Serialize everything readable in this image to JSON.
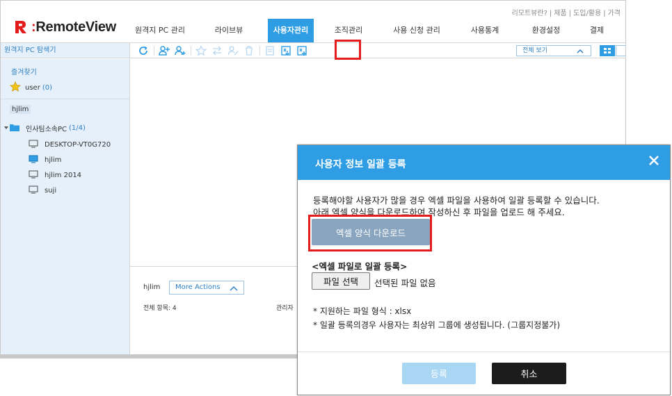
{
  "toplinks": [
    "리모트뷰란?",
    "제품",
    "도입/활용",
    "가격"
  ],
  "app": {
    "name": "RemoteView",
    "brand_color": "#e31b1b"
  },
  "nav": [
    {
      "label": "원격지 PC 관리"
    },
    {
      "label": "라이브뷰"
    },
    {
      "label": "사용자관리"
    },
    {
      "label": "조직관리"
    },
    {
      "label": "사용 신청 관리"
    },
    {
      "label": "사용통계"
    },
    {
      "label": "환경설정"
    },
    {
      "label": "결제"
    }
  ],
  "sidebar": {
    "title": "원격지 PC 탐색기",
    "favorites_title": "즐겨찾기",
    "fav_user": "user",
    "fav_count": "(0)",
    "group": "hjlim",
    "folder": "인사팀소속PC",
    "folder_count": "(1/4)",
    "pcs": [
      {
        "name": "DESKTOP-VT0G720"
      },
      {
        "name": "hjlim"
      },
      {
        "name": "hjlim 2014"
      },
      {
        "name": "suji"
      }
    ]
  },
  "toolbar": {
    "view_select": "전체 보기"
  },
  "bottom": {
    "user": "hjlim",
    "more_actions": "More Actions",
    "total": "전체 항목: 4",
    "admin": "관리자"
  },
  "dialog": {
    "title": "사용자 정보 일괄 등록",
    "desc1": "등록해야할 사용자가 많을 경우 엑셀 파일을 사용하여 일괄 등록할 수 있습니다.",
    "desc2": "아래 엑셀 양식을 다운로드하여 작성하신 후 파일을 업로드 해 주세요.",
    "download_button": "엑셀 양식 다운로드",
    "upload_title": "<엑셀 파일로 일괄 등록>",
    "file_button": "파일 선택",
    "file_none": "선택된 파일 없음",
    "note1": "* 지원하는 파일 형식 : xlsx",
    "note2": "* 일괄 등록의경우 사용자는 최상위 그룹에 생성됩니다. (그룹지정불가)",
    "ok_button": "등록",
    "cancel_button": "취소"
  },
  "colors": {
    "accent": "#2f9de3",
    "highlight": "#e31b1b"
  }
}
